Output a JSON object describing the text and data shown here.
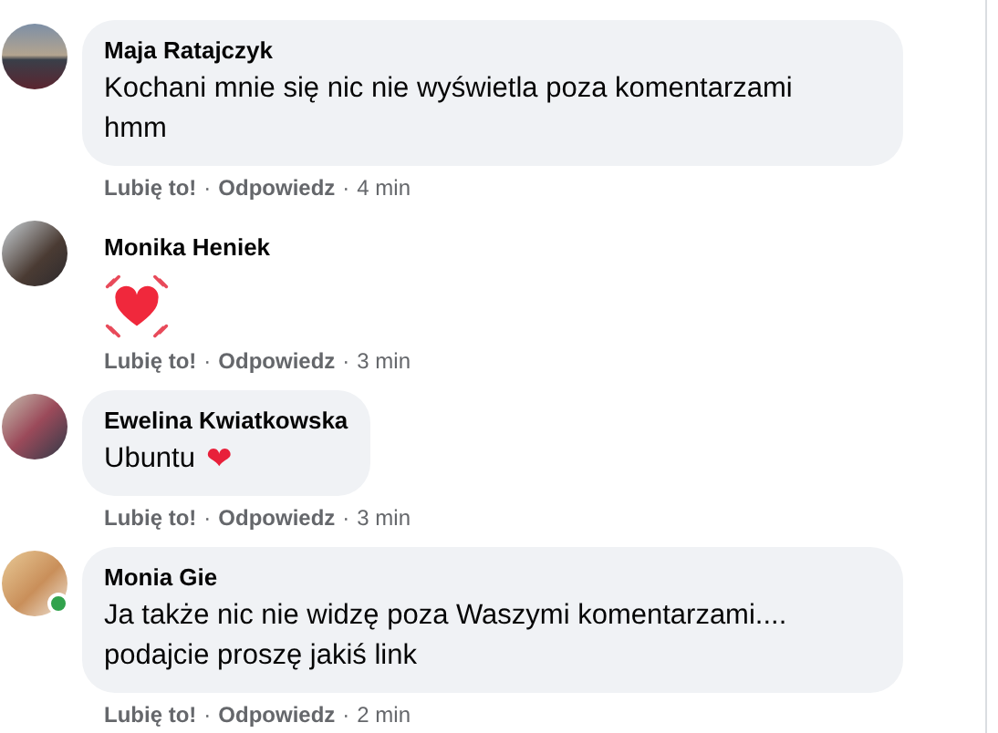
{
  "separator": "·",
  "comments": [
    {
      "author": "Maja Ratajczyk",
      "kind": "text",
      "online": false,
      "lines": [
        "Kochani mnie się nic nie wyświetla poza komentarzami",
        "hmm"
      ],
      "like": "Lubię to!",
      "reply": "Odpowiedz",
      "time": "4 min"
    },
    {
      "author": "Monika Heniek",
      "kind": "sticker",
      "online": false,
      "like": "Lubię to!",
      "reply": "Odpowiedz",
      "time": "3 min"
    },
    {
      "author": "Ewelina Kwiatkowska",
      "kind": "text",
      "online": false,
      "lines": [
        "Ubuntu"
      ],
      "emoji": "❤",
      "like": "Lubię to!",
      "reply": "Odpowiedz",
      "time": "3 min"
    },
    {
      "author": "Monia Gie",
      "kind": "text",
      "online": true,
      "lines": [
        "Ja także nic nie widzę poza Waszymi komentarzami....",
        "podajcie proszę jakiś link"
      ],
      "like": "Lubię to!",
      "reply": "Odpowiedz",
      "time": "2 min"
    }
  ]
}
